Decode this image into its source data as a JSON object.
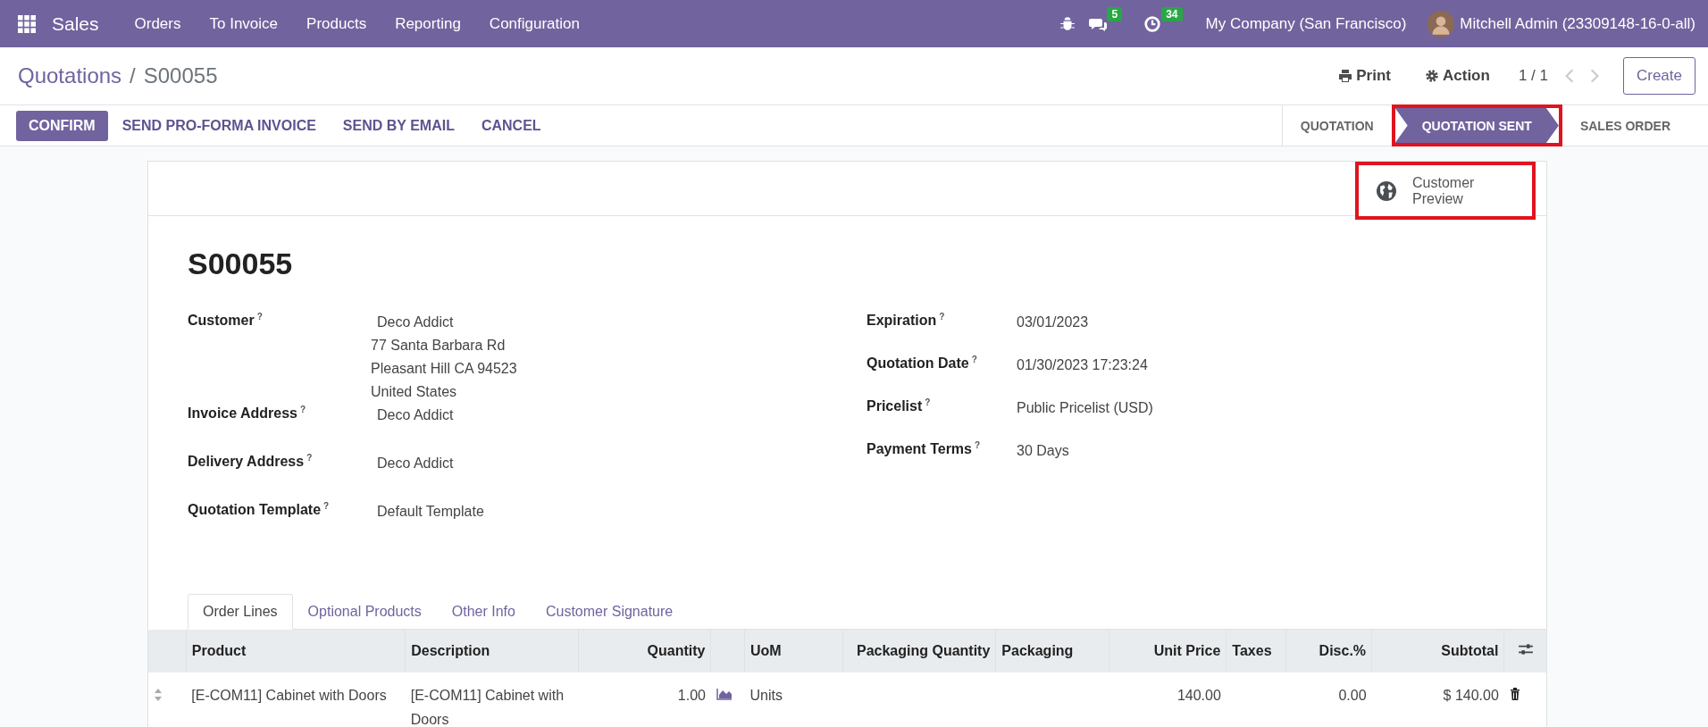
{
  "navbar": {
    "app": "Sales",
    "menu": [
      "Orders",
      "To Invoice",
      "Products",
      "Reporting",
      "Configuration"
    ],
    "messages_badge": "5",
    "activities_badge": "34",
    "company": "My Company (San Francisco)",
    "user": "Mitchell Admin (23309148-16-0-all)"
  },
  "breadcrumb": {
    "parent": "Quotations",
    "separator": "/",
    "current": "S00055"
  },
  "control_panel": {
    "print": "Print",
    "action": "Action",
    "pager": "1 / 1",
    "create": "Create"
  },
  "actions": [
    {
      "label": "CONFIRM",
      "primary": true
    },
    {
      "label": "SEND PRO-FORMA INVOICE",
      "primary": false
    },
    {
      "label": "SEND BY EMAIL",
      "primary": false
    },
    {
      "label": "CANCEL",
      "primary": false
    }
  ],
  "stages": [
    {
      "label": "QUOTATION",
      "selected": false,
      "highlighted": false
    },
    {
      "label": "QUOTATION SENT",
      "selected": true,
      "highlighted": true
    },
    {
      "label": "SALES ORDER",
      "selected": false,
      "highlighted": false
    }
  ],
  "preview_button": {
    "label": "Customer Preview",
    "highlighted": true
  },
  "title": "S00055",
  "left_fields": [
    {
      "label": "Customer",
      "lines": [
        "Deco Addict",
        "77 Santa Barbara Rd",
        "Pleasant Hill CA 94523",
        "United States"
      ]
    },
    {
      "label": "Invoice Address",
      "lines": [
        "Deco Addict"
      ]
    },
    {
      "label": "Delivery Address",
      "lines": [
        "Deco Addict"
      ]
    },
    {
      "label": "Quotation Template",
      "lines": [
        "Default Template"
      ]
    }
  ],
  "right_fields": [
    {
      "label": "Expiration",
      "value": "03/01/2023"
    },
    {
      "label": "Quotation Date",
      "value": "01/30/2023 17:23:24"
    },
    {
      "label": "Pricelist",
      "value": "Public Pricelist (USD)"
    },
    {
      "label": "Payment Terms",
      "value": "30 Days"
    }
  ],
  "help_mark": "?",
  "tabs": [
    {
      "label": "Order Lines",
      "selected": true
    },
    {
      "label": "Optional Products",
      "selected": false
    },
    {
      "label": "Other Info",
      "selected": false
    },
    {
      "label": "Customer Signature",
      "selected": false
    }
  ],
  "table": {
    "columns": {
      "product": "Product",
      "description": "Description",
      "quantity": "Quantity",
      "uom": "UoM",
      "packaging_quantity": "Packaging Quantity",
      "packaging": "Packaging",
      "unit_price": "Unit Price",
      "taxes": "Taxes",
      "discount": "Disc.%",
      "subtotal": "Subtotal"
    },
    "rows": [
      {
        "product": "[E-COM11] Cabinet with Doors",
        "description": "[E-COM11] Cabinet with Doors",
        "quantity": "1.00",
        "uom": "Units",
        "unit_price": "140.00",
        "discount": "0.00",
        "subtotal": "$ 140.00"
      }
    ]
  }
}
